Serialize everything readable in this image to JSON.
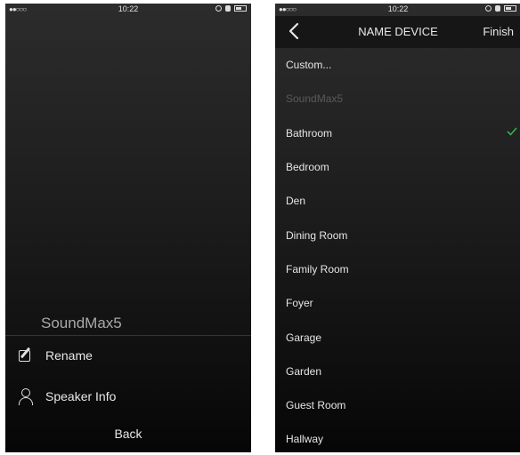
{
  "left": {
    "status": {
      "signal": "●●○○○",
      "time": "10:22"
    },
    "device_name": "SoundMax5",
    "menu": [
      {
        "label": "Rename",
        "icon": "edit-icon"
      },
      {
        "label": "Speaker Info",
        "icon": "user-icon"
      }
    ],
    "back_label": "Back"
  },
  "right": {
    "status": {
      "signal": "●●○○○",
      "time": "10:22"
    },
    "nav": {
      "title": "NAME DEVICE",
      "finish_label": "Finish"
    },
    "items": [
      {
        "label": "Custom...",
        "dim": false,
        "checked": false
      },
      {
        "label": "SoundMax5",
        "dim": true,
        "checked": false
      },
      {
        "label": "Bathroom",
        "dim": false,
        "checked": true
      },
      {
        "label": "Bedroom",
        "dim": false,
        "checked": false
      },
      {
        "label": "Den",
        "dim": false,
        "checked": false
      },
      {
        "label": "Dining Room",
        "dim": false,
        "checked": false
      },
      {
        "label": "Family Room",
        "dim": false,
        "checked": false
      },
      {
        "label": "Foyer",
        "dim": false,
        "checked": false
      },
      {
        "label": "Garage",
        "dim": false,
        "checked": false
      },
      {
        "label": "Garden",
        "dim": false,
        "checked": false
      },
      {
        "label": "Guest Room",
        "dim": false,
        "checked": false
      },
      {
        "label": "Hallway",
        "dim": false,
        "checked": false
      }
    ],
    "check_color": "#2fb24c"
  }
}
